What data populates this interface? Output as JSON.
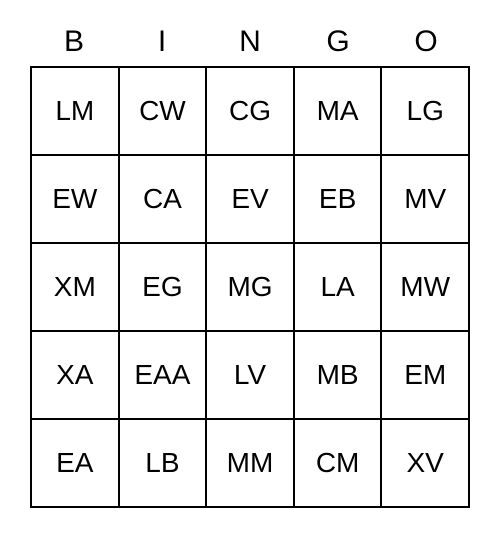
{
  "header": [
    "B",
    "I",
    "N",
    "G",
    "O"
  ],
  "grid": [
    [
      "LM",
      "CW",
      "CG",
      "MA",
      "LG"
    ],
    [
      "EW",
      "CA",
      "EV",
      "EB",
      "MV"
    ],
    [
      "XM",
      "EG",
      "MG",
      "LA",
      "MW"
    ],
    [
      "XA",
      "EAA",
      "LV",
      "MB",
      "EM"
    ],
    [
      "EA",
      "LB",
      "MM",
      "CM",
      "XV"
    ]
  ]
}
